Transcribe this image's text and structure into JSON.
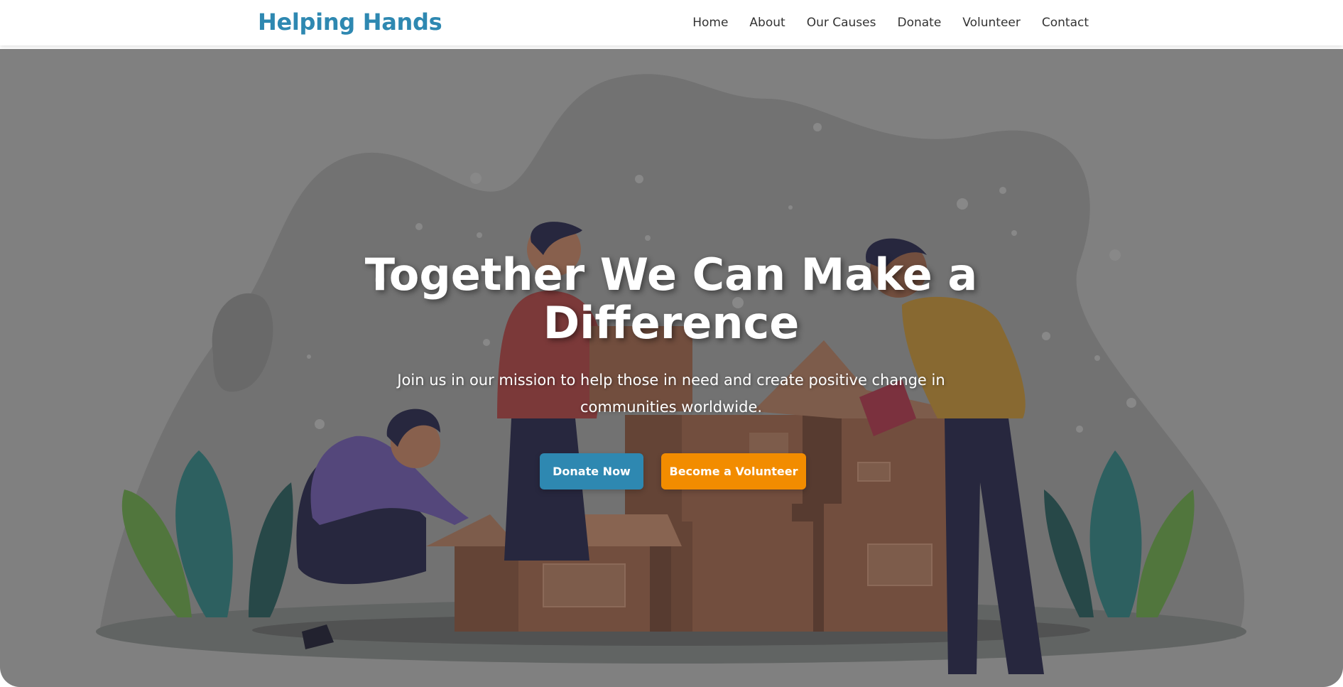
{
  "brand": {
    "name": "Helping Hands",
    "color": "#2e88b1"
  },
  "nav": {
    "items": [
      {
        "label": "Home"
      },
      {
        "label": "About"
      },
      {
        "label": "Our Causes"
      },
      {
        "label": "Donate"
      },
      {
        "label": "Volunteer"
      },
      {
        "label": "Contact"
      }
    ]
  },
  "hero": {
    "title": "Together We Can Make a Difference",
    "subtitle": "Join us in our mission to help those in need and create positive change in communities worldwide.",
    "primary_cta": "Donate Now",
    "secondary_cta": "Become a Volunteer",
    "primary_color": "#2e88b1",
    "secondary_color": "#f28c00",
    "illustration": "volunteers-packing-donation-boxes"
  }
}
